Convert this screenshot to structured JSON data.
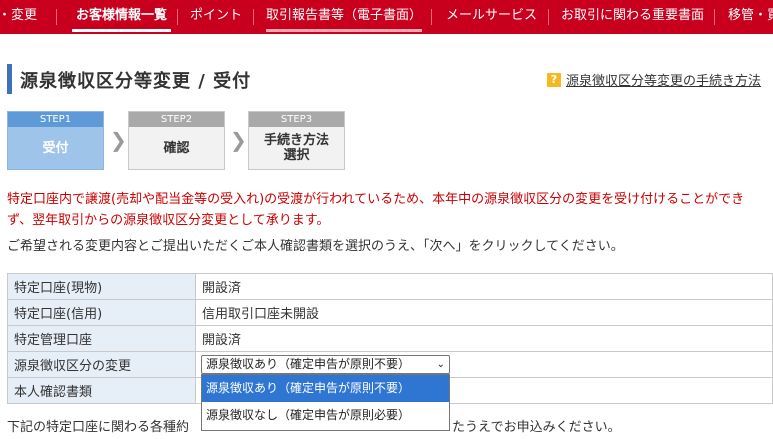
{
  "nav": {
    "items": [
      {
        "label": "住所・変更",
        "display": "・変更"
      },
      {
        "label": "お客様情報一覧"
      },
      {
        "label": "ポイント"
      },
      {
        "label": "取引報告書等（電子書面）"
      },
      {
        "label": "メールサービス"
      },
      {
        "label": "お取引に関わる重要書面"
      },
      {
        "label": "移管・買"
      }
    ],
    "bg_color": "#c8001e"
  },
  "page": {
    "title": "源泉徴収区分等変更 / 受付",
    "help_link": "源泉徴収区分等変更の手続き方法",
    "help_icon_char": "?"
  },
  "steps": [
    {
      "label": "STEP1",
      "name": "受付"
    },
    {
      "label": "STEP2",
      "name": "確認"
    },
    {
      "label": "STEP3",
      "name": "手続き方法\n選択"
    }
  ],
  "notice_red": "特定口座内で譲渡(売却や配当金等の受入れ)の受渡が行われているため、本年中の源泉徴収区分の変更を受け付けることができず、翌年取引からの源泉徴収区分変更として承ります。",
  "notice": "ご希望される変更内容とご提出いただくご本人確認書類を選択のうえ、「次へ」をクリックしてください。",
  "table": {
    "rows": [
      {
        "header": "特定口座(現物)",
        "value": "開設済"
      },
      {
        "header": "特定口座(信用)",
        "value": "信用取引口座未開設"
      },
      {
        "header": "特定管理口座",
        "value": "開設済"
      },
      {
        "header": "源泉徴収区分の変更",
        "value": ""
      },
      {
        "header": "本人確認書類",
        "value": ""
      }
    ]
  },
  "withholding_select": {
    "selected": "源泉徴収あり（確定申告が原則不要）",
    "options": [
      "源泉徴収あり（確定申告が原則不要）",
      "源泉徴収なし（確定申告が原則必要）"
    ],
    "highlight_color": "#2f76d2"
  },
  "footer": {
    "left": "下記の特定口座に関わる各種約",
    "right": "たうえでお申込みください。"
  }
}
